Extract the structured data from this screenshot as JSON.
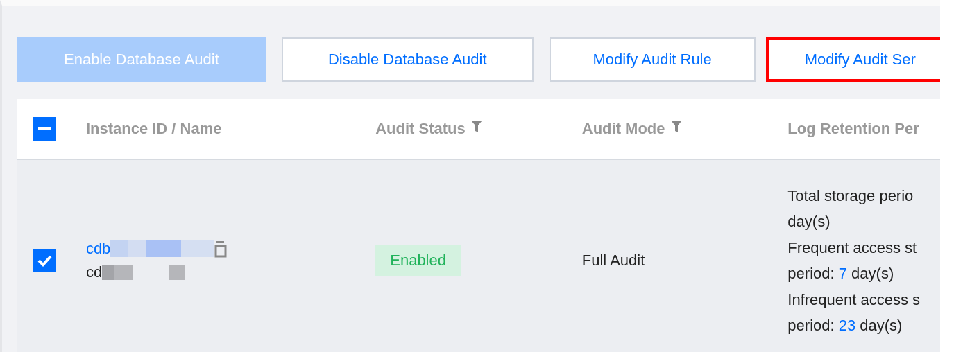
{
  "toolbar": {
    "buttons": [
      {
        "label": "Enable Database Audit",
        "disabled": true,
        "highlighted": false
      },
      {
        "label": "Disable Database Audit",
        "disabled": false,
        "highlighted": false
      },
      {
        "label": "Modify Audit Rule",
        "disabled": false,
        "highlighted": false
      },
      {
        "label": "Modify Audit Ser",
        "disabled": false,
        "highlighted": true
      }
    ]
  },
  "table": {
    "select_all": {
      "indeterminate": true
    },
    "columns": [
      {
        "label": "Instance ID / Name"
      },
      {
        "label": "Audit Status",
        "filter": true
      },
      {
        "label": "Audit Mode",
        "filter": true
      },
      {
        "label": "Log Retention Per"
      }
    ],
    "rows": [
      {
        "checked": true,
        "instance_id": "cdb",
        "instance_name": "cd",
        "audit_status": "Enabled",
        "audit_mode": "Full Audit",
        "retention": [
          {
            "text": "Total storage perio"
          },
          {
            "text": "day(s)"
          },
          {
            "text": "Frequent access st"
          },
          {
            "text": "period: ",
            "value": "7",
            "after": " day(s)"
          },
          {
            "text": "Infrequent access s"
          },
          {
            "text": "period: ",
            "value": "23",
            "after": " day(s)"
          }
        ]
      }
    ]
  }
}
